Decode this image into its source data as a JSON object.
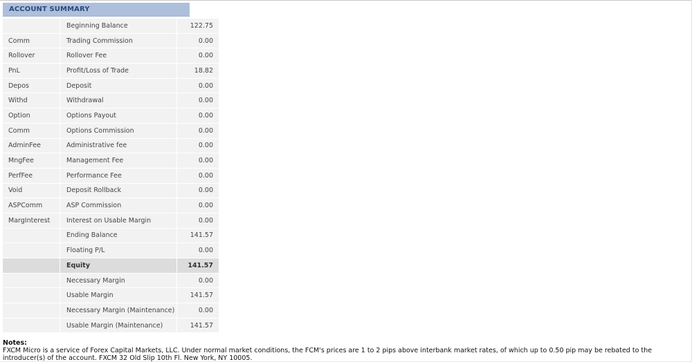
{
  "summary": {
    "title": "ACCOUNT SUMMARY",
    "rows": [
      {
        "code": "",
        "description": "Beginning Balance",
        "value": "122.75",
        "highlight": false
      },
      {
        "code": "Comm",
        "description": "Trading Commission",
        "value": "0.00",
        "highlight": false
      },
      {
        "code": "Rollover",
        "description": "Rollover Fee",
        "value": "0.00",
        "highlight": false
      },
      {
        "code": "PnL",
        "description": "Profit/Loss of Trade",
        "value": "18.82",
        "highlight": false
      },
      {
        "code": "Depos",
        "description": "Deposit",
        "value": "0.00",
        "highlight": false
      },
      {
        "code": "Withd",
        "description": "Withdrawal",
        "value": "0.00",
        "highlight": false
      },
      {
        "code": "Option",
        "description": "Options Payout",
        "value": "0.00",
        "highlight": false
      },
      {
        "code": "Comm",
        "description": "Options Commission",
        "value": "0.00",
        "highlight": false
      },
      {
        "code": "AdminFee",
        "description": "Administrative fee",
        "value": "0.00",
        "highlight": false
      },
      {
        "code": "MngFee",
        "description": "Management Fee",
        "value": "0.00",
        "highlight": false
      },
      {
        "code": "PerfFee",
        "description": "Performance Fee",
        "value": "0.00",
        "highlight": false
      },
      {
        "code": "Void",
        "description": "Deposit Rollback",
        "value": "0.00",
        "highlight": false
      },
      {
        "code": "ASPComm",
        "description": "ASP Commission",
        "value": "0.00",
        "highlight": false
      },
      {
        "code": "MargInterest",
        "description": "Interest on Usable Margin",
        "value": "0.00",
        "highlight": false
      },
      {
        "code": "",
        "description": "Ending Balance",
        "value": "141.57",
        "highlight": false
      },
      {
        "code": "",
        "description": "Floating P/L",
        "value": "0.00",
        "highlight": false
      },
      {
        "code": "",
        "description": "Equity",
        "value": "141.57",
        "highlight": true
      },
      {
        "code": "",
        "description": "Necessary Margin",
        "value": "0.00",
        "highlight": false
      },
      {
        "code": "",
        "description": "Usable Margin",
        "value": "141.57",
        "highlight": false
      },
      {
        "code": "",
        "description": "Necessary Margin (Maintenance)",
        "value": "0.00",
        "highlight": false
      },
      {
        "code": "",
        "description": "Usable Margin (Maintenance)",
        "value": "141.57",
        "highlight": false
      }
    ]
  },
  "notes": {
    "title": "Notes:",
    "text": "FXCM Micro is a service of Forex Capital Markets, LLC. Under normal market conditions, the FCM's prices are 1 to 2 pips above interbank market rates, of which up to 0.50 pip may be rebated to the introducer(s) of the account. FXCM 32 Old Slip 10th Fl. New York, NY 10005."
  },
  "colors": {
    "header_bg": "#aebfdb",
    "header_text": "#2c4a7c",
    "row_bg": "#f2f2f2",
    "highlight_row_bg": "#dcdcdc"
  }
}
